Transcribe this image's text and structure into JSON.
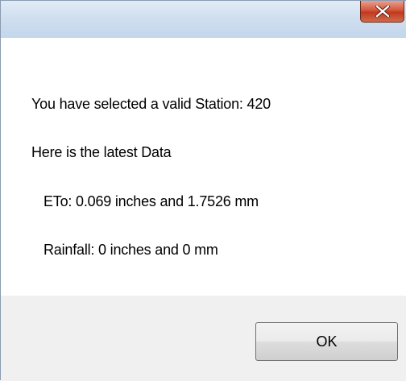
{
  "dialog": {
    "title": "",
    "close_icon": "close-x-icon",
    "colors": {
      "titlebar": "#c9daef",
      "close_button": "#c7432a",
      "footer": "#f0f0f0"
    }
  },
  "message": {
    "line1": "You have selected a valid Station: 420",
    "line2": "Here is the latest Data",
    "line3": "ETo: 0.069 inches and 1.7526 mm",
    "line4": "Rainfall: 0 inches and 0 mm"
  },
  "buttons": {
    "ok_label": "OK"
  }
}
